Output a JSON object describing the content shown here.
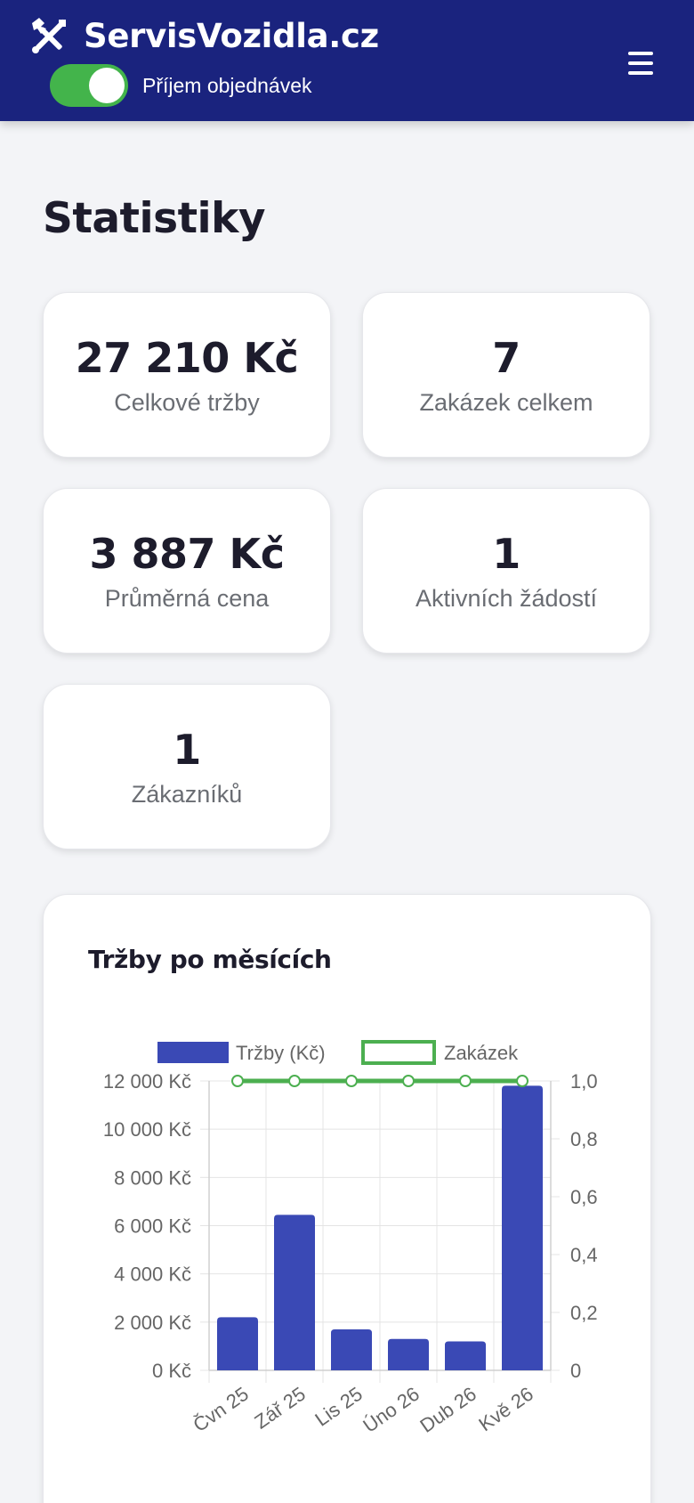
{
  "header": {
    "brand": "ServisVozidla.cz",
    "toggle_label": "Příjem objednávek",
    "toggle_on": true
  },
  "page": {
    "title": "Statistiky"
  },
  "stats": [
    {
      "value": "27 210 Kč",
      "label": "Celkové tržby"
    },
    {
      "value": "7",
      "label": "Zakázek celkem"
    },
    {
      "value": "3 887 Kč",
      "label": "Průměrná cena"
    },
    {
      "value": "1",
      "label": "Aktivních žádostí"
    },
    {
      "value": "1",
      "label": "Zákazníků"
    }
  ],
  "colors": {
    "header_bg": "#1a237e",
    "toggle_on": "#43b44b",
    "bar": "#3a49b5",
    "line": "#4caf50"
  },
  "chart_data": {
    "type": "bar",
    "title": "Tržby po měsících",
    "categories": [
      "Čvn 25",
      "Zář 25",
      "Lis 25",
      "Úno 26",
      "Dub 26",
      "Kvě 26"
    ],
    "series": [
      {
        "name": "Tržby (Kč)",
        "type": "bar",
        "axis": "left",
        "values": [
          2200,
          6450,
          1700,
          1300,
          1200,
          11800
        ]
      },
      {
        "name": "Zakázek",
        "type": "line",
        "axis": "right",
        "values": [
          1,
          1,
          1,
          1,
          1,
          1
        ]
      }
    ],
    "y_left": {
      "min": 0,
      "max": 12000,
      "ticks": [
        "0 Kč",
        "2 000 Kč",
        "4 000 Kč",
        "6 000 Kč",
        "8 000 Kč",
        "10 000 Kč",
        "12 000 Kč"
      ]
    },
    "y_right": {
      "min": 0,
      "max": 1,
      "ticks": [
        "0",
        "0,2",
        "0,4",
        "0,6",
        "0,8",
        "1,0"
      ]
    },
    "grid": true,
    "legend": "top"
  }
}
